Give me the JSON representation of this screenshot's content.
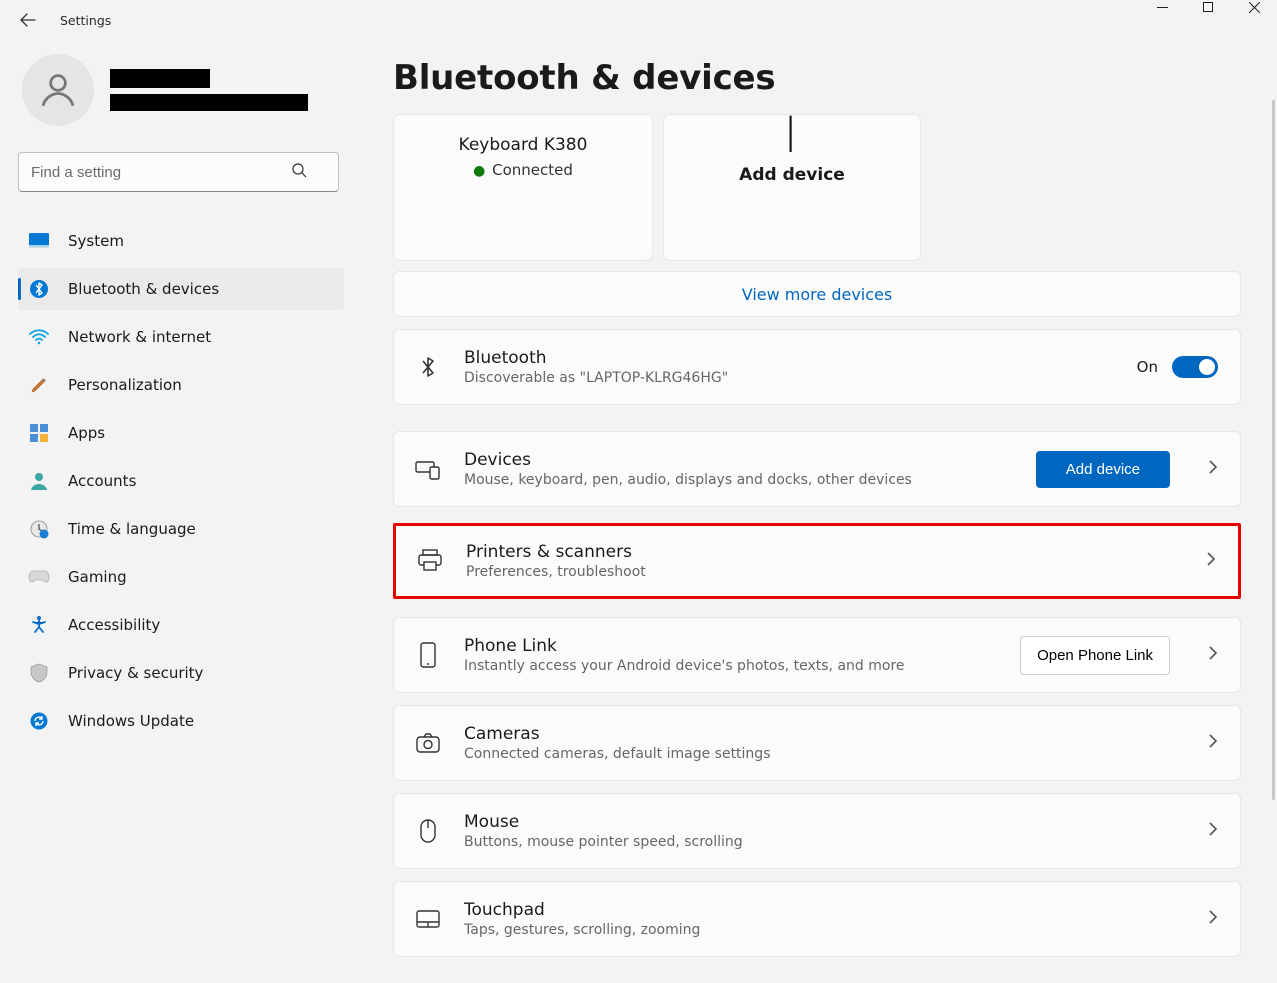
{
  "window": {
    "title": "Settings"
  },
  "search": {
    "placeholder": "Find a setting"
  },
  "sidebar": {
    "items": [
      {
        "label": "System"
      },
      {
        "label": "Bluetooth & devices"
      },
      {
        "label": "Network & internet"
      },
      {
        "label": "Personalization"
      },
      {
        "label": "Apps"
      },
      {
        "label": "Accounts"
      },
      {
        "label": "Time & language"
      },
      {
        "label": "Gaming"
      },
      {
        "label": "Accessibility"
      },
      {
        "label": "Privacy & security"
      },
      {
        "label": "Windows Update"
      }
    ]
  },
  "main": {
    "heading": "Bluetooth & devices",
    "device_card": {
      "name": "Keyboard K380",
      "status": "Connected"
    },
    "add_device": "Add device",
    "view_more": "View more devices",
    "bluetooth": {
      "title": "Bluetooth",
      "subtitle": "Discoverable as \"LAPTOP-KLRG46HG\"",
      "state": "On"
    },
    "devices": {
      "title": "Devices",
      "subtitle": "Mouse, keyboard, pen, audio, displays and docks, other devices",
      "button": "Add device"
    },
    "printers": {
      "title": "Printers & scanners",
      "subtitle": "Preferences, troubleshoot"
    },
    "phone": {
      "title": "Phone Link",
      "subtitle": "Instantly access your Android device's photos, texts, and more",
      "button": "Open Phone Link"
    },
    "cameras": {
      "title": "Cameras",
      "subtitle": "Connected cameras, default image settings"
    },
    "mouse": {
      "title": "Mouse",
      "subtitle": "Buttons, mouse pointer speed, scrolling"
    },
    "touchpad": {
      "title": "Touchpad",
      "subtitle": "Taps, gestures, scrolling, zooming"
    }
  }
}
